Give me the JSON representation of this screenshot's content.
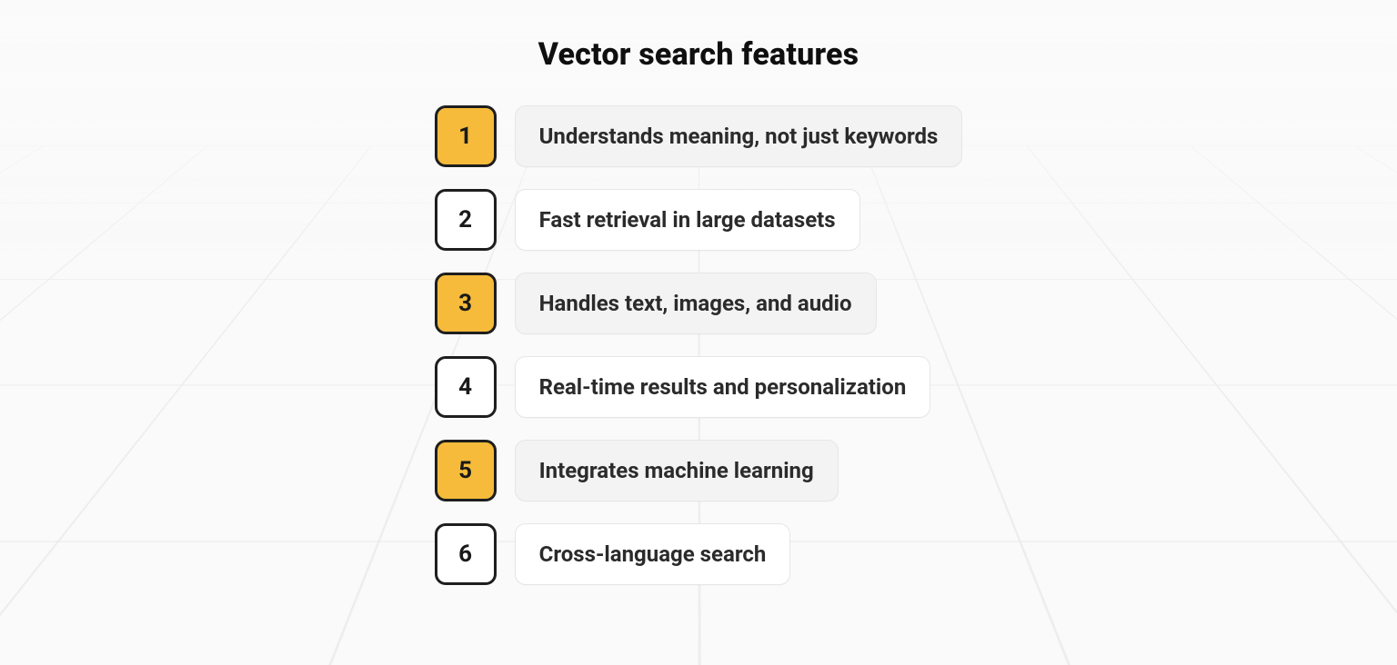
{
  "title": "Vector search features",
  "colors": {
    "accent": "#f6bb3a",
    "border_dark": "#1e1e1e",
    "card_grey": "#f3f3f3",
    "card_white": "#ffffff",
    "background": "#fafafa"
  },
  "features": [
    {
      "num": "1",
      "label": "Understands meaning, not just keywords",
      "highlight": true
    },
    {
      "num": "2",
      "label": "Fast retrieval in large datasets",
      "highlight": false
    },
    {
      "num": "3",
      "label": "Handles text, images, and audio",
      "highlight": true
    },
    {
      "num": "4",
      "label": "Real-time results and personalization",
      "highlight": false
    },
    {
      "num": "5",
      "label": "Integrates machine learning",
      "highlight": true
    },
    {
      "num": "6",
      "label": "Cross-language search",
      "highlight": false
    }
  ]
}
